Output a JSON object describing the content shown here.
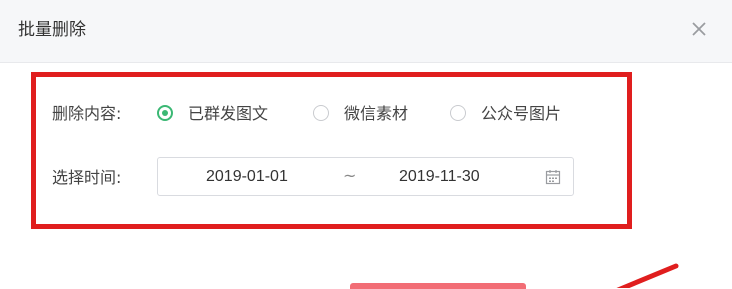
{
  "dialog": {
    "title": "批量删除",
    "close_icon": "close-icon"
  },
  "delete_content": {
    "label": "删除内容:",
    "options": [
      {
        "label": "已群发图文",
        "checked": true
      },
      {
        "label": "微信素材",
        "checked": false
      },
      {
        "label": "公众号图片",
        "checked": false
      }
    ],
    "accent_color": "#3bb874"
  },
  "select_time": {
    "label": "选择时间:",
    "start_date": "2019-01-01",
    "separator": "~",
    "end_date": "2019-11-30",
    "icon": "calendar-icon"
  },
  "annotation": {
    "highlight_color": "#e01e1e"
  }
}
